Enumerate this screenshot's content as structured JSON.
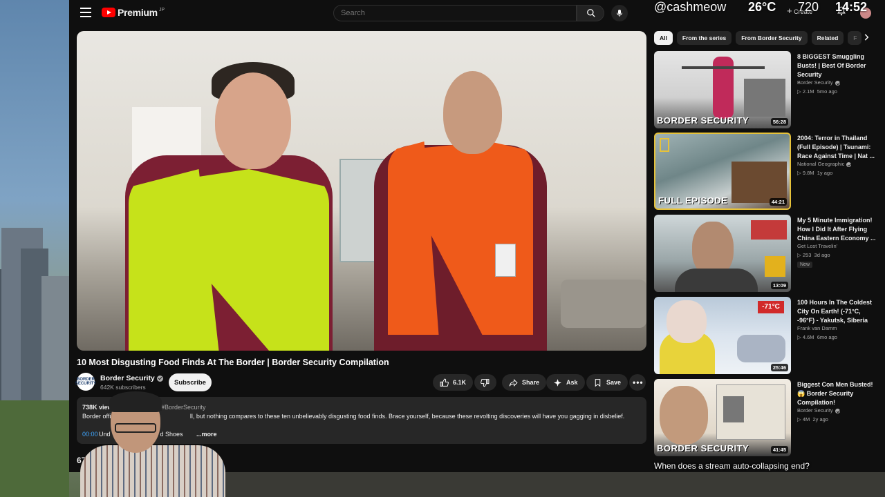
{
  "overlay": {
    "username": "@cashmeow",
    "temperature": "26°C",
    "resolution": "720",
    "clock": "14:52"
  },
  "header": {
    "logo_text": "Premium",
    "logo_region": "JP",
    "search_placeholder": "Search",
    "create_label": "Create"
  },
  "video": {
    "title": "10 Most Disgusting Food Finds At The Border | Border Security Compilation",
    "channel": "Border Security",
    "channel_avatar_text": "BORDER SECURITY",
    "subscribers": "642K subscribers",
    "subscribe_label": "Subscribe",
    "likes": "6.1K",
    "share_label": "Share",
    "ask_label": "Ask",
    "save_label": "Save",
    "views": "738K views",
    "hashtag": "#BorderSecurity",
    "description_start": "Border offic",
    "description_rest": "ll, but nothing compares to these ten unbelievably disgusting food finds. Brace yourself, because these revolting discoveries will have you gagging in disbelief.",
    "chapter_time": "00:00",
    "chapter_label_a": "Und",
    "chapter_label_b": "d Shoes",
    "more_label": "...more",
    "comments_count": "677"
  },
  "chips": [
    "All",
    "From the series",
    "From Border Security",
    "Related",
    "F"
  ],
  "recommendations": [
    {
      "title": "8 BIGGEST Smuggling Busts! | Best Of Border Security",
      "channel": "Border Security",
      "verified": true,
      "views": "2.1M",
      "age": "5mo ago",
      "duration": "56:28",
      "banner": "BORDER SECURITY",
      "new": ""
    },
    {
      "title": "2004: Terror in Thailand (Full Episode) | Tsunami: Race Against Time | Nat ...",
      "channel": "National Geographic",
      "verified": true,
      "views": "9.8M",
      "age": "1y ago",
      "duration": "44:21",
      "banner": "FULL EPISODE",
      "new": ""
    },
    {
      "title": "My 5 Minute Immigration! How I Did It After Flying China Eastern Economy ...",
      "channel": "Get Lost Travelin'",
      "verified": false,
      "views": "253",
      "age": "3d ago",
      "duration": "13:09",
      "banner": "",
      "new": "New"
    },
    {
      "title": "100 Hours In The Coldest City On Earth! (-71°C, -96°F) - Yakutsk, Siberia",
      "channel": "Frank van Damm",
      "verified": false,
      "views": "4.6M",
      "age": "6mo ago",
      "duration": "25:46",
      "banner": "",
      "new": ""
    },
    {
      "title": "Biggest Con Men Busted! 😱 Border Security Compilation!",
      "channel": "Border Security",
      "verified": true,
      "views": "4M",
      "age": "2y ago",
      "duration": "41:45",
      "banner": "BORDER SECURITY",
      "new": ""
    }
  ],
  "chat": {
    "line": "When does a stream auto-collapsing end?"
  },
  "colors": {
    "background": "#0f0f0f",
    "surface": "#272727",
    "brand_red": "#ff0000",
    "link_blue": "#3ea6ff"
  }
}
